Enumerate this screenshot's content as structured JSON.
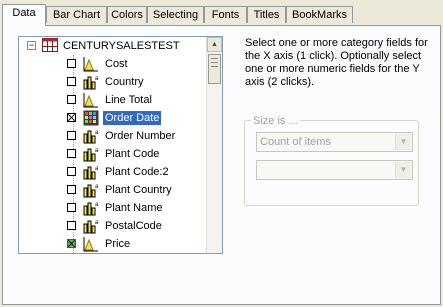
{
  "tabs": [
    {
      "label": "Data",
      "active": true
    },
    {
      "label": "Bar Chart",
      "active": false
    },
    {
      "label": "Colors",
      "active": false
    },
    {
      "label": "Selecting",
      "active": false
    },
    {
      "label": "Fonts",
      "active": false
    },
    {
      "label": "Titles",
      "active": false
    },
    {
      "label": "BookMarks",
      "active": false
    }
  ],
  "tree": {
    "root_label": "CENTURYSALESTEST",
    "root_expander": "−",
    "fields": [
      {
        "label": "Cost",
        "checked": false,
        "icon": "measure-field-icon"
      },
      {
        "label": "Country",
        "checked": false,
        "icon": "category-field-icon"
      },
      {
        "label": "Line Total",
        "checked": false,
        "icon": "measure-field-icon"
      },
      {
        "label": "Order Date",
        "checked": true,
        "icon": "date-field-icon",
        "selected": true
      },
      {
        "label": "Order Number",
        "checked": false,
        "icon": "category-field-icon"
      },
      {
        "label": "Plant Code",
        "checked": false,
        "icon": "category-field-icon"
      },
      {
        "label": "Plant Code:2",
        "checked": false,
        "icon": "category-field-icon"
      },
      {
        "label": "Plant Country",
        "checked": false,
        "icon": "category-field-icon"
      },
      {
        "label": "Plant Name",
        "checked": false,
        "icon": "category-field-icon"
      },
      {
        "label": "PostalCode",
        "checked": false,
        "icon": "category-field-icon"
      },
      {
        "label": "Price",
        "checked": true,
        "icon": "measure-field-icon"
      }
    ]
  },
  "instructions": "Select one or more category fields for the X axis (1 click).  Optionally select one or more numeric fields for the Y axis (2 clicks).",
  "size": {
    "legend": "Size is ...",
    "combo1_value": "Count of items",
    "combo2_value": ""
  },
  "colors": {
    "selection": "#316ac5",
    "tab_border": "#919b9c"
  }
}
